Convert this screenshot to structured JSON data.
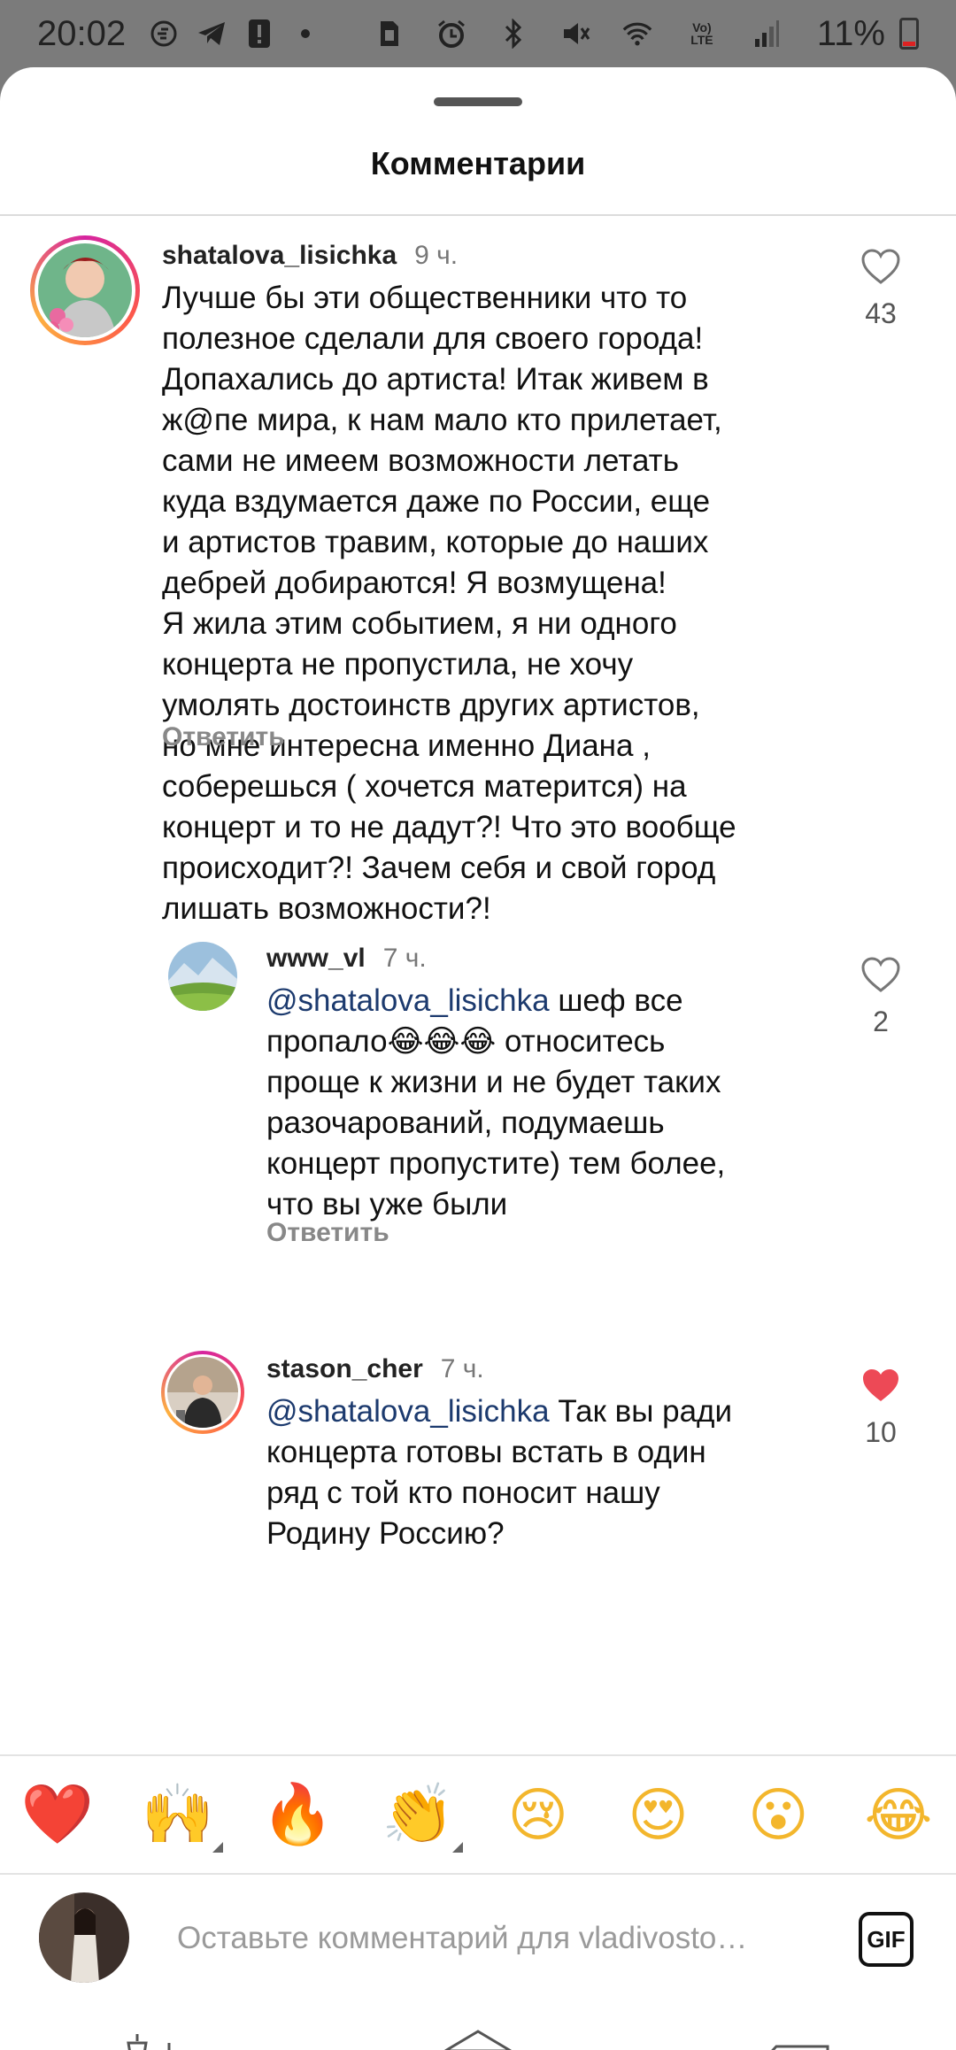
{
  "status_bar": {
    "time": "20:02",
    "battery": "11%",
    "icons": [
      "speed-icon",
      "telegram-icon",
      "alert-icon",
      "dot-icon",
      "sim-icon",
      "alarm-icon",
      "bluetooth-icon",
      "mute-icon",
      "wifi-icon",
      "volte-icon",
      "signal-icon",
      "battery-icon"
    ]
  },
  "sheet": {
    "title": "Комментарии"
  },
  "comments": [
    {
      "username": "shatalova_lisichka",
      "time": "9 ч.",
      "text": "Лучше бы эти общественники что то\nполезное сделали для своего города!\nДопахались до артиста! Итак живем в\nж@пе мира, к нам мало кто прилетает,\nсами не имеем возможности летать\nкуда вздумается даже по России, еще\nи артистов травим, которые до наших\nдебрей добираются! Я возмущена!\nЯ жила этим событием, я ни одного\nконцерта не пропустила, не хочу\nумолять достоинств других артистов,\nно мне интересна именно Диана ,\nсоберешься ( хочется матерится) на\nконцерт и то не дадут?! Что это вообще\nпроисходит?! Зачем себя и свой город\nлишать возможности?!",
      "reply_label": "Ответить",
      "likes": "43",
      "liked": false
    },
    {
      "username": "www_vl",
      "time": "7 ч.",
      "mention": "@shatalova_lisichka",
      "text": " шеф все\nпропало😂😂😂 относитесь\nпроще к жизни и не будет таких\nразочарований, подумаешь\nконцерт пропустите) тем более,\nчто вы уже были",
      "reply_label": "Ответить",
      "likes": "2",
      "liked": false
    },
    {
      "username": "stason_cher",
      "time": "7 ч.",
      "mention": "@shatalova_lisichka",
      "text": " Так вы ради\nконцерта готовы встать в один\nряд с той кто поносит нашу\nРодину Россию?",
      "likes": "10",
      "liked": true
    }
  ],
  "emoji_bar": [
    "❤️",
    "🙌",
    "🔥",
    "👏",
    "😢",
    "😍",
    "😮",
    "😂"
  ],
  "input": {
    "placeholder": "Оставьте комментарий для vladivosto…",
    "gif_label": "GIF"
  },
  "colors": {
    "like_active": "#ed4956",
    "mention": "#1c3a6e",
    "muted": "#888888"
  },
  "nav": [
    "lamps-icon",
    "house-icon",
    "back-sign-icon"
  ]
}
